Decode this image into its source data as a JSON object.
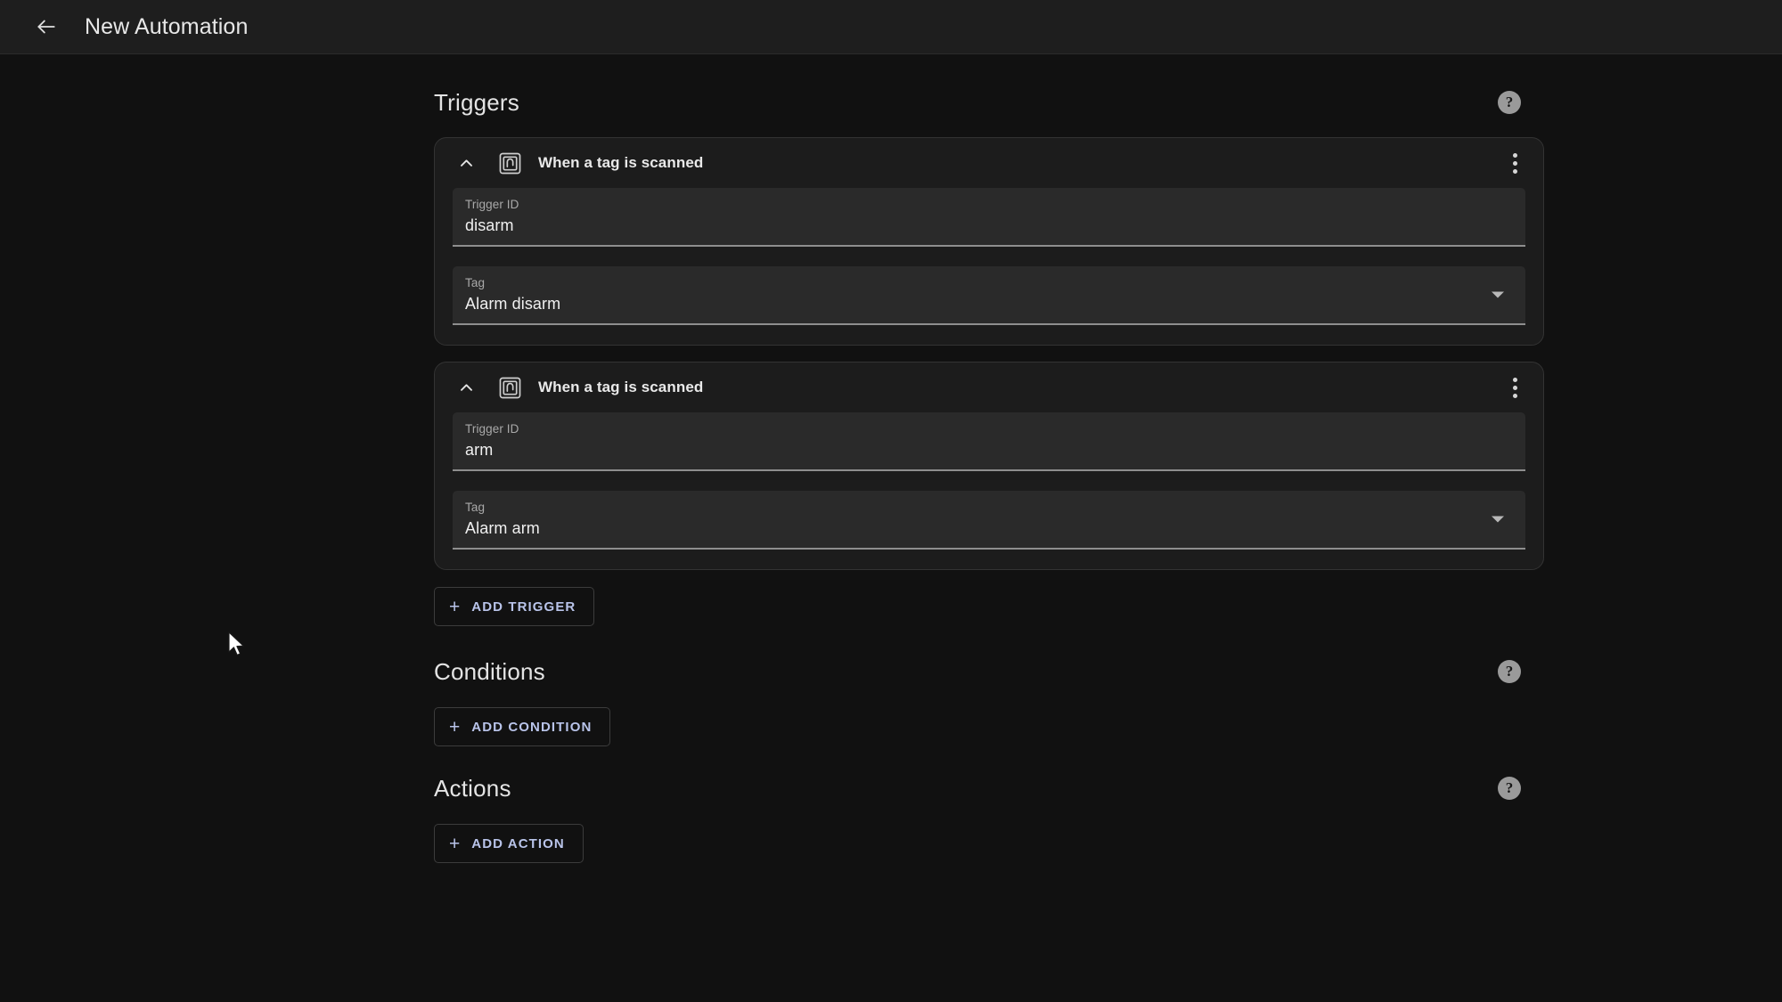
{
  "topbar": {
    "back_icon": "arrow-left-icon",
    "title": "New Automation"
  },
  "sections": {
    "triggers": {
      "title": "Triggers",
      "help_icon": "help-circle-icon",
      "help_label": "?",
      "add_button": {
        "label": "ADD TRIGGER",
        "plus": "+"
      },
      "cards": [
        {
          "icon": "nfc-tag-icon",
          "collapse_icon": "chevron-up-icon",
          "title": "When a tag is scanned",
          "overflow_icon": "dots-vertical-icon",
          "fields": [
            {
              "label": "Trigger ID",
              "value": "disarm",
              "type": "text"
            },
            {
              "label": "Tag",
              "value": "Alarm disarm",
              "type": "select"
            }
          ]
        },
        {
          "icon": "nfc-tag-icon",
          "collapse_icon": "chevron-up-icon",
          "title": "When a tag is scanned",
          "overflow_icon": "dots-vertical-icon",
          "fields": [
            {
              "label": "Trigger ID",
              "value": "arm",
              "type": "text"
            },
            {
              "label": "Tag",
              "value": "Alarm arm",
              "type": "select"
            }
          ]
        }
      ]
    },
    "conditions": {
      "title": "Conditions",
      "help_icon": "help-circle-icon",
      "help_label": "?",
      "add_button": {
        "label": "ADD CONDITION",
        "plus": "+"
      }
    },
    "actions": {
      "title": "Actions",
      "help_icon": "help-circle-icon",
      "help_label": "?",
      "add_button": {
        "label": "ADD ACTION",
        "plus": "+"
      }
    }
  },
  "colors": {
    "accent": "#b9c4ea",
    "app_bar": "#1e1e1e",
    "background": "#111111",
    "card": "#1c1c1c",
    "field": "#2a2a2a"
  },
  "cursor": {
    "icon": "mouse-pointer"
  }
}
